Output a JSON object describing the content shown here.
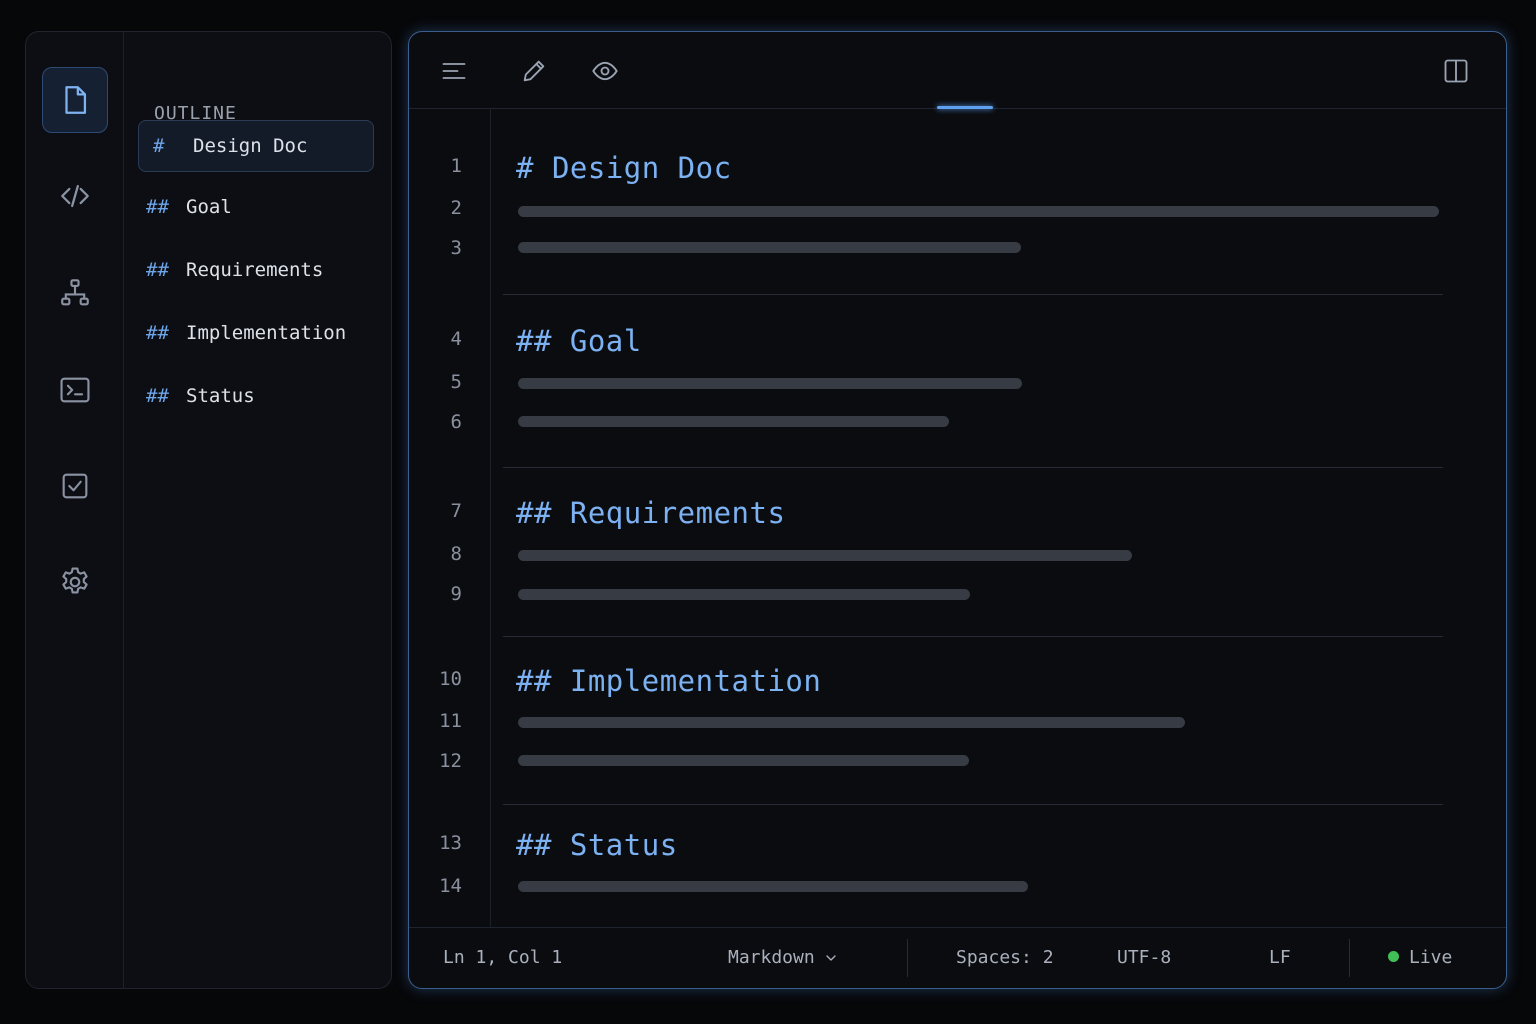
{
  "outline": {
    "title": "OUTLINE",
    "items": [
      {
        "marker": "#",
        "label": "Design Doc",
        "active": true
      },
      {
        "marker": "##",
        "label": "Goal"
      },
      {
        "marker": "##",
        "label": "Requirements"
      },
      {
        "marker": "##",
        "label": "Implementation"
      },
      {
        "marker": "##",
        "label": "Status"
      }
    ]
  },
  "activity_bar": {
    "icons": [
      "file-icon",
      "code-icon",
      "hierarchy-icon",
      "terminal-icon",
      "checkbox-icon",
      "settings-icon"
    ],
    "active": "file-icon"
  },
  "toolbar": {
    "icons": [
      "menu-icon",
      "edit-icon",
      "preview-icon",
      "split-view-icon"
    ],
    "active_tab": "preview-icon"
  },
  "editor": {
    "sections": [
      {
        "line": "1",
        "marker": "#",
        "title": "Design Doc",
        "body_lines": [
          "2",
          "3"
        ]
      },
      {
        "line": "4",
        "marker": "##",
        "title": "Goal",
        "body_lines": [
          "5",
          "6"
        ]
      },
      {
        "line": "7",
        "marker": "##",
        "title": "Requirements",
        "body_lines": [
          "8",
          "9"
        ]
      },
      {
        "line": "10",
        "marker": "##",
        "title": "Implementation",
        "body_lines": [
          "11",
          "12"
        ]
      },
      {
        "line": "13",
        "marker": "##",
        "title": "Status",
        "body_lines": [
          "14"
        ]
      }
    ],
    "heading_color": "#7cb1f2"
  },
  "statusbar": {
    "position": "Ln 1, Col 1",
    "language": "Markdown",
    "indent": "Spaces: 2",
    "encoding": "UTF-8",
    "eol": "LF",
    "live": "Live",
    "live_color": "#3fbf55"
  }
}
